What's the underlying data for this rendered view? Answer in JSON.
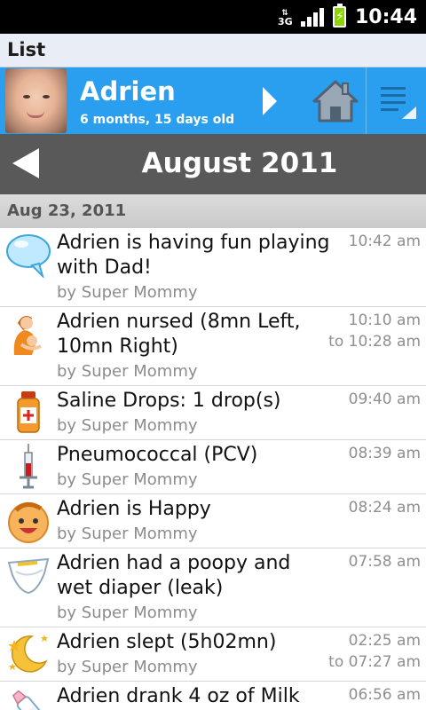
{
  "status_bar": {
    "network": "3G",
    "time": "10:44",
    "icons": [
      "3g-icon",
      "signal-icon",
      "battery-charging-icon"
    ]
  },
  "app": {
    "title": "List"
  },
  "profile": {
    "name": "Adrien",
    "age": "6 months, 15 days old",
    "accent_color": "#2a9ff0"
  },
  "month_nav": {
    "title": "August 2011"
  },
  "date_header": "Aug 23, 2011",
  "entries": [
    {
      "icon": "speech-bubble-icon",
      "title": "Adrien is having fun playing with Dad!",
      "author": "by Super Mommy",
      "time": "10:42 am",
      "time_end": ""
    },
    {
      "icon": "nursing-mother-icon",
      "title": "Adrien nursed (8mn Left, 10mn Right)",
      "author": "by Super Mommy",
      "time": "10:10 am",
      "time_end": "to 10:28 am"
    },
    {
      "icon": "medicine-bottle-icon",
      "title": "Saline Drops: 1 drop(s)",
      "author": "by Super Mommy",
      "time": "09:40 am",
      "time_end": ""
    },
    {
      "icon": "syringe-icon",
      "title": "Pneumococcal (PCV)",
      "author": "by Super Mommy",
      "time": "08:39 am",
      "time_end": ""
    },
    {
      "icon": "happy-baby-face-icon",
      "title": "Adrien is Happy",
      "author": "by Super Mommy",
      "time": "08:24 am",
      "time_end": ""
    },
    {
      "icon": "diaper-icon",
      "title": "Adrien had a poopy and wet diaper (leak)",
      "author": "by Super Mommy",
      "time": "07:58 am",
      "time_end": ""
    },
    {
      "icon": "moon-stars-icon",
      "title": "Adrien slept (5h02mn)",
      "author": "by Super Mommy",
      "time": "02:25 am",
      "time_end": "to 07:27 am"
    },
    {
      "icon": "baby-bottle-icon",
      "title": "Adrien drank 4 oz of Milk",
      "author": "",
      "time": "06:56 am",
      "time_end": ""
    }
  ]
}
